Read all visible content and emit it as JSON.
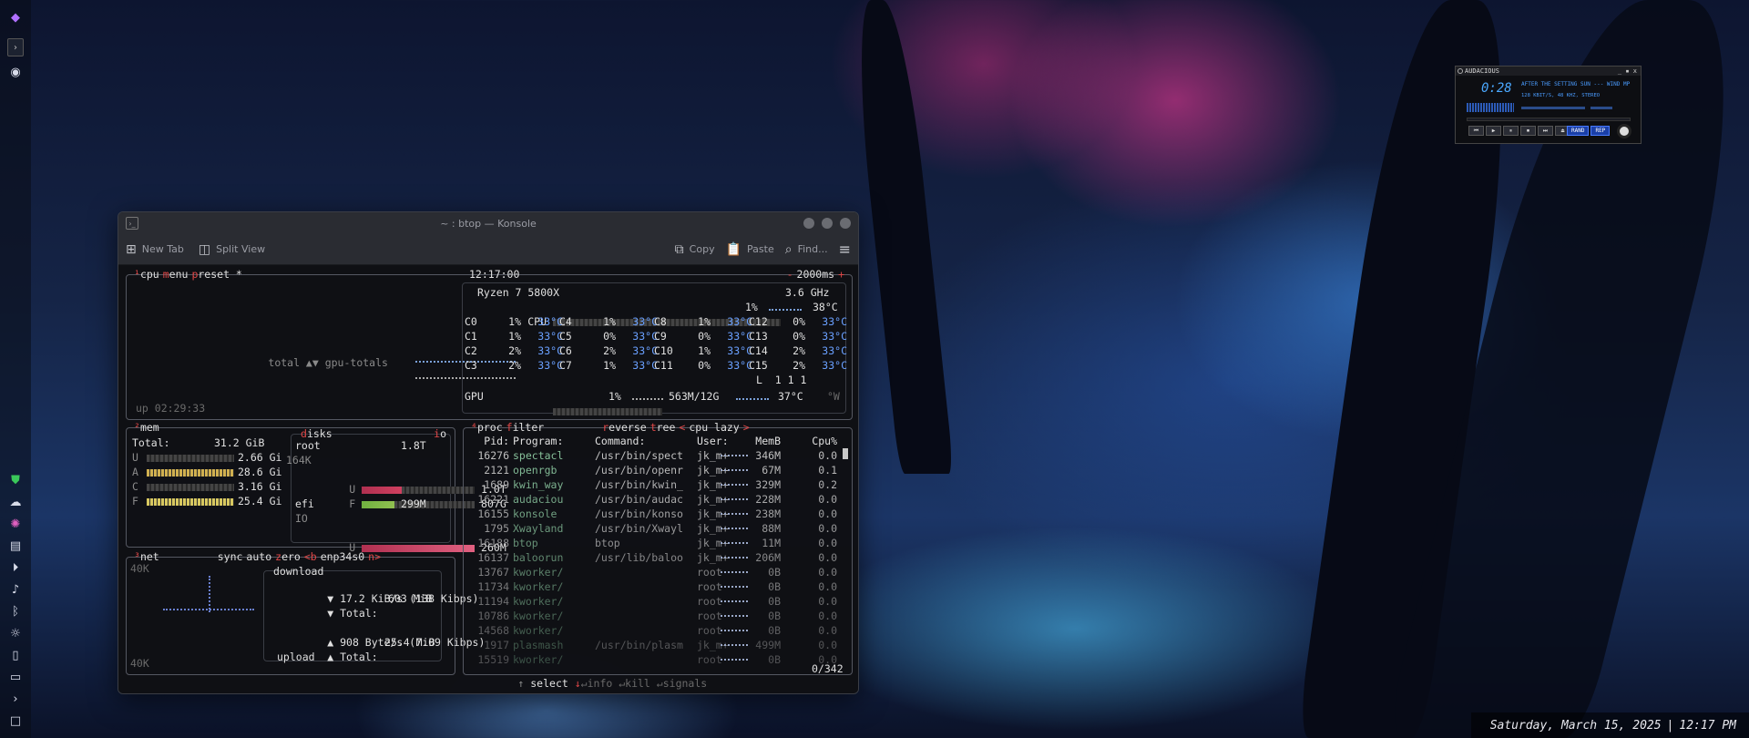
{
  "dock": {
    "icons": [
      "kde-launcher-icon",
      "terminal-icon",
      "audacious-icon",
      "shield-icon",
      "cloud-icon",
      "color-wheel-icon",
      "clipboard-icon",
      "media-play-icon",
      "volume-icon",
      "bluetooth-icon",
      "brightness-icon",
      "battery-icon",
      "display-icon",
      "expand-icon",
      "desktop-icon"
    ]
  },
  "konsole": {
    "title": "~ : btop — Konsole",
    "toolbar": {
      "new_tab": "New Tab",
      "split_view": "Split View",
      "copy": "Copy",
      "paste": "Paste",
      "find": "Find..."
    }
  },
  "btop": {
    "cpu_box": {
      "tab_cpu_key": "¹",
      "tab_cpu": "cpu",
      "tab_menu_key": "m",
      "tab_menu": "enu",
      "tab_preset_key": "p",
      "tab_preset": "reset *",
      "time": "12:17:00",
      "refresh": "2000ms",
      "graph_label": "total ▲▼ gpu-totals",
      "uptime": "up 02:29:33",
      "model": "Ryzen 7 5800X",
      "freq": "3.6 GHz",
      "cpu_total_label": "CPU",
      "cpu_total_pct": "1%",
      "cpu_total_temp": "38°C",
      "cores": [
        [
          "C0",
          "1%",
          "33°C",
          "C4",
          "1%",
          "33°C",
          "C8",
          "1%",
          "33°C",
          "C12",
          "0%",
          "33°C"
        ],
        [
          "C1",
          "1%",
          "33°C",
          "C5",
          "0%",
          "33°C",
          "C9",
          "0%",
          "33°C",
          "C13",
          "0%",
          "33°C"
        ],
        [
          "C2",
          "2%",
          "33°C",
          "C6",
          "2%",
          "33°C",
          "C10",
          "1%",
          "33°C",
          "C14",
          "2%",
          "33°C"
        ],
        [
          "C3",
          "2%",
          "33°C",
          "C7",
          "1%",
          "33°C",
          "C11",
          "0%",
          "33°C",
          "C15",
          "2%",
          "33°C"
        ]
      ],
      "load_avg": "L  1 1 1",
      "gpu_label": "GPU",
      "gpu_pct": "1%",
      "gpu_mem": "563M/12G",
      "gpu_temp": "37°C",
      "gpu_power": "°W"
    },
    "mem_box": {
      "key": "²",
      "title": "mem",
      "total_label": "Total:",
      "total": "31.2 GiB",
      "rows": [
        {
          "k": "U",
          "v": "2.66 Gi"
        },
        {
          "k": "A",
          "v": "28.6 Gi"
        },
        {
          "k": "C",
          "v": "3.16 Gi"
        },
        {
          "k": "F",
          "v": "25.4 Gi"
        }
      ]
    },
    "disks_box": {
      "key": "d",
      "title": "isks",
      "io_key": "i",
      "io": "o",
      "root_label": "root",
      "root_size": "1.8T",
      "root_io": "164K",
      "root_used": "1.0T",
      "root_free": "807G",
      "efi_label": "efi",
      "efi_size": "299M",
      "efi_io": "IO",
      "efi_used": "260M"
    },
    "net_box": {
      "key": "³",
      "title": "net",
      "sync": "sync",
      "auto": "auto",
      "zero_key": "z",
      "zero": "ero",
      "iface_prev": "<b",
      "iface": "enp34s0",
      "iface_next": "n>",
      "scale_top": "40K",
      "scale_bottom": "40K",
      "download_label": "download",
      "down_rate": "17.2 KiB/s",
      "down_rate_bits": "(138 Kibps)",
      "down_total_label": "Total:",
      "down_total": "603 MiB",
      "up_rate": "908 Byte/s",
      "up_rate_bits": "(7.09 Kibps)",
      "up_total_label": "Total:",
      "up_total": "25.4 MiB",
      "upload_label": "upload"
    },
    "proc_box": {
      "key": "⁴",
      "title": "proc",
      "filter_key": "f",
      "filter": "ilter",
      "reverse_key": "r",
      "reverse": "everse",
      "tree_key": "t",
      "tree": "ree",
      "sort": "cpu lazy",
      "columns": [
        "Pid:",
        "Program:",
        "Command:",
        "User:",
        "MemB",
        "Cpu%"
      ],
      "rows": [
        [
          "16276",
          "spectacl",
          "/usr/bin/spect",
          "jk_m+",
          "346M",
          "0.0"
        ],
        [
          "2121",
          "openrgb",
          "/usr/bin/openr",
          "jk_m+",
          "67M",
          "0.1"
        ],
        [
          "1689",
          "kwin_way",
          "/usr/bin/kwin_",
          "jk_m+",
          "329M",
          "0.2"
        ],
        [
          "16221",
          "audaciou",
          "/usr/bin/audac",
          "jk_m+",
          "228M",
          "0.0"
        ],
        [
          "16155",
          "konsole",
          "/usr/bin/konso",
          "jk_m+",
          "238M",
          "0.0"
        ],
        [
          "1795",
          "Xwayland",
          "/usr/bin/Xwayl",
          "jk_m+",
          "88M",
          "0.0"
        ],
        [
          "16188",
          "btop",
          "btop",
          "jk_m+",
          "11M",
          "0.0"
        ],
        [
          "16137",
          "baloorun",
          "/usr/lib/baloo",
          "jk_m+",
          "206M",
          "0.0"
        ],
        [
          "13767",
          "kworker/",
          "",
          "root",
          "0B",
          "0.0"
        ],
        [
          "11734",
          "kworker/",
          "",
          "root",
          "0B",
          "0.0"
        ],
        [
          "11194",
          "kworker/",
          "",
          "root",
          "0B",
          "0.0"
        ],
        [
          "10786",
          "kworker/",
          "",
          "root",
          "0B",
          "0.0"
        ],
        [
          "14568",
          "kworker/",
          "",
          "root",
          "0B",
          "0.0"
        ],
        [
          "1917",
          "plasmash",
          "/usr/bin/plasm",
          "jk_m+",
          "499M",
          "0.0"
        ],
        [
          "15519",
          "kworker/",
          "",
          "root",
          "0B",
          "0.0"
        ]
      ],
      "footer_select": "select",
      "footer_info": "info",
      "footer_kill": "kill",
      "footer_signals": "signals",
      "count": "0/342"
    }
  },
  "audacious": {
    "title": "AUDACIOUS",
    "title_buttons": "_ ▪ x",
    "time": "0:28",
    "song": "AFTER THE SETTING SUN --- WIND MP",
    "info": "128 KBIT/S, 48 KHZ, STEREO",
    "buttons": [
      "⏮",
      "▶",
      "⏸",
      "⏹",
      "⏭",
      "⏏"
    ],
    "shuffle": "RAND",
    "repeat": "REP"
  },
  "clock": {
    "date": "Saturday, March 15, 2025",
    "separator": "|",
    "time": "12:17 PM"
  }
}
